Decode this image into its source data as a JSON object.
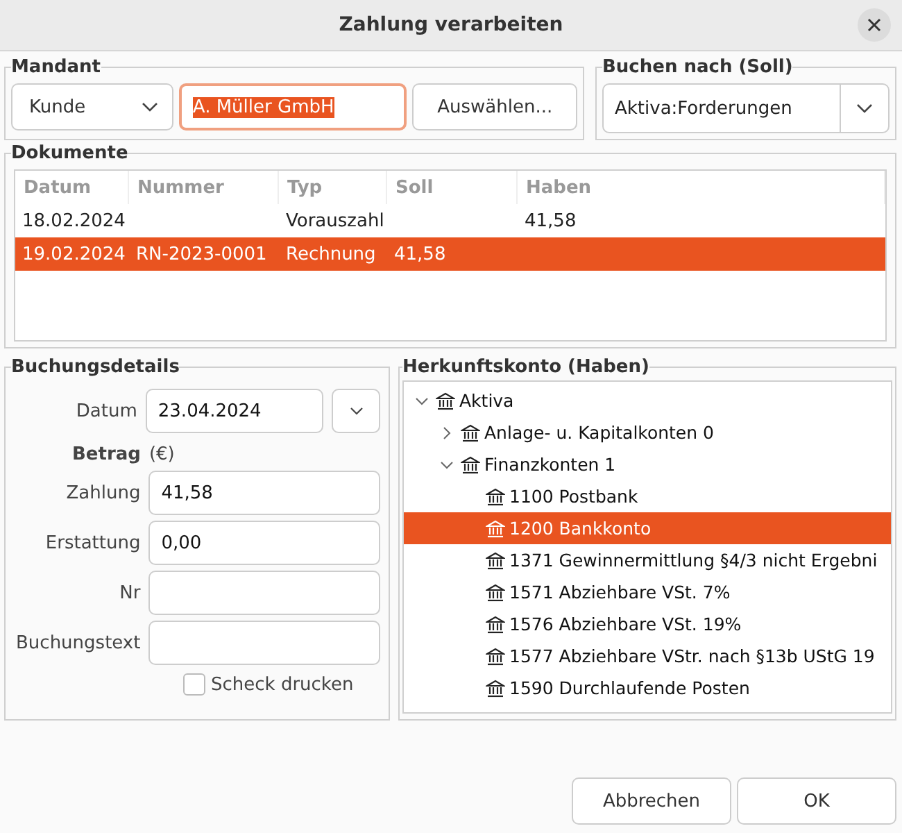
{
  "window": {
    "title": "Zahlung verarbeiten"
  },
  "mandant": {
    "title": "Mandant",
    "type_select": "Kunde",
    "name_field": {
      "value": "A. Müller GmbH",
      "focused": true,
      "text_selected": true
    },
    "choose_button": "Auswählen..."
  },
  "buchen_nach": {
    "title": "Buchen nach (Soll)",
    "value": "Aktiva:Forderungen"
  },
  "dokumente": {
    "title": "Dokumente",
    "columns": [
      "Datum",
      "Nummer",
      "Typ",
      "Soll",
      "Haben"
    ],
    "rows": [
      {
        "cells": [
          "18.02.2024",
          null,
          "Vorauszahl",
          null,
          "41,58"
        ],
        "selected": false
      },
      {
        "cells": [
          "19.02.2024",
          "RN-2023-0001",
          "Rechnung",
          "41,58",
          null
        ],
        "selected": true
      }
    ]
  },
  "buchungsdetails": {
    "title": "Buchungsdetails",
    "date_label": "Datum",
    "date_value": "23.04.2024",
    "amount_label": "Betrag",
    "currency": "(€)",
    "fields": [
      {
        "label": "Zahlung",
        "value": "41,58"
      },
      {
        "label": "Erstattung",
        "value": "0,00"
      },
      {
        "label": "Nr"
      },
      {
        "label": "Buchungstext"
      }
    ],
    "print_check": {
      "label": "Scheck drucken",
      "checked": false
    }
  },
  "herkunftskonto": {
    "title": "Herkunftskonto (Haben)",
    "tree": [
      {
        "label": "Aktiva",
        "expanded": true,
        "selected": false,
        "children": [
          {
            "label": "Anlage- u. Kapitalkonten 0",
            "expanded": false,
            "selected": false
          },
          {
            "label": "Finanzkonten 1",
            "expanded": true,
            "selected": false,
            "children": [
              {
                "label": "1100 Postbank",
                "selected": false
              },
              {
                "label": "1200 Bankkonto",
                "selected": true
              },
              {
                "label": "1371 Gewinnermittlung §4/3 nicht Ergebni",
                "selected": false
              },
              {
                "label": "1571 Abziehbare VSt. 7%",
                "selected": false
              },
              {
                "label": "1576 Abziehbare VSt. 19%",
                "selected": false
              },
              {
                "label": "1577 Abziehbare VStr. nach §13b UStG 19",
                "selected": false
              },
              {
                "label": "1590 Durchlaufende Posten",
                "selected": false
              }
            ]
          }
        ]
      }
    ]
  },
  "buttons": [
    "Abbrechen",
    "OK"
  ]
}
